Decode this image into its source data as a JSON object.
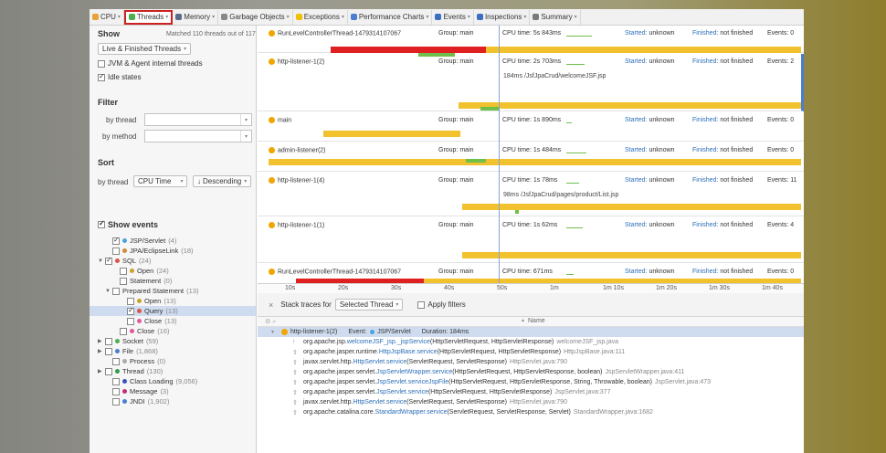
{
  "tabs": [
    {
      "label": "CPU",
      "icon": "cpu-icon",
      "color": "#e8a13b",
      "active": false
    },
    {
      "label": "Threads",
      "icon": "threads-icon",
      "color": "#4caf50",
      "active": true
    },
    {
      "label": "Memory",
      "icon": "memory-icon",
      "color": "#5a6b8a",
      "active": false
    },
    {
      "label": "Garbage Objects",
      "icon": "garbage-icon",
      "color": "#888888",
      "active": false
    },
    {
      "label": "Exceptions",
      "icon": "lightning-icon",
      "color": "#f0c000",
      "active": false
    },
    {
      "label": "Performance Charts",
      "icon": "chart-icon",
      "color": "#4a7fd0",
      "active": false
    },
    {
      "label": "Events",
      "icon": "events-icon",
      "color": "#3a6fc0",
      "active": false
    },
    {
      "label": "Inspections",
      "icon": "inspections-icon",
      "color": "#3a6fc0",
      "active": false
    },
    {
      "label": "Summary",
      "icon": "summary-icon",
      "color": "#7a7a7a",
      "active": false
    }
  ],
  "left": {
    "show_title": "Show",
    "matched": "Matched 110 threads out of 117",
    "filter_mode": "Live & Finished Threads",
    "jvm_agent": "JVM & Agent internal threads",
    "idle_states": "Idle states",
    "filter_title": "Filter",
    "by_thread": "by thread",
    "by_method": "by method",
    "sort_title": "Sort",
    "sort_by": "by thread",
    "sort_field": "CPU Time",
    "sort_order": "Descending",
    "show_events": "Show events",
    "tree": [
      {
        "label": "JSP/Servlet",
        "count": "(4)",
        "color": "#4aa3e0",
        "checked": true,
        "indent": 1,
        "expander": "",
        "sel": false
      },
      {
        "label": "JPA/EclipseLink",
        "count": "(18)",
        "color": "#d08a3a",
        "checked": false,
        "indent": 1,
        "expander": "",
        "sel": false
      },
      {
        "label": "SQL",
        "count": "(24)",
        "color": "#e0534a",
        "checked": true,
        "indent": 0,
        "expander": "▼",
        "sel": false
      },
      {
        "label": "Open",
        "count": "(24)",
        "color": "#c9a227",
        "checked": false,
        "indent": 2,
        "expander": "",
        "sel": false
      },
      {
        "label": "Statement",
        "count": "(0)",
        "color": "",
        "checked": false,
        "indent": 2,
        "expander": "",
        "sel": false
      },
      {
        "label": "Prepared Statement",
        "count": "(13)",
        "color": "",
        "checked": false,
        "indent": 1,
        "expander": "▼",
        "sel": false
      },
      {
        "label": "Open",
        "count": "(13)",
        "color": "#c9a227",
        "checked": false,
        "indent": 3,
        "expander": "",
        "sel": false
      },
      {
        "label": "Query",
        "count": "(13)",
        "color": "#e0534a",
        "checked": true,
        "indent": 3,
        "expander": "",
        "sel": true
      },
      {
        "label": "Close",
        "count": "(13)",
        "color": "#e05aa0",
        "checked": false,
        "indent": 3,
        "expander": "",
        "sel": false
      },
      {
        "label": "Close",
        "count": "(16)",
        "color": "#e05aa0",
        "checked": false,
        "indent": 2,
        "expander": "",
        "sel": false
      },
      {
        "label": "Socket",
        "count": "(59)",
        "color": "#4caf50",
        "checked": false,
        "indent": 0,
        "expander": "▶",
        "sel": false
      },
      {
        "label": "File",
        "count": "(1,868)",
        "color": "#4a7fd0",
        "checked": false,
        "indent": 0,
        "expander": "▶",
        "sel": false
      },
      {
        "label": "Process",
        "count": "(0)",
        "color": "#aaaaaa",
        "checked": false,
        "indent": 1,
        "expander": "",
        "sel": false
      },
      {
        "label": "Thread",
        "count": "(130)",
        "color": "#2e9c4a",
        "checked": false,
        "indent": 0,
        "expander": "▶",
        "sel": false
      },
      {
        "label": "Class Loading",
        "count": "(9,056)",
        "color": "#3355bb",
        "checked": false,
        "indent": 1,
        "expander": "",
        "sel": false
      },
      {
        "label": "Message",
        "count": "(3)",
        "color": "#c0307a",
        "checked": false,
        "indent": 1,
        "expander": "",
        "sel": false
      },
      {
        "label": "JNDI",
        "count": "(1,902)",
        "color": "#4a7fd0",
        "checked": false,
        "indent": 1,
        "expander": "",
        "sel": false
      }
    ]
  },
  "threads": [
    {
      "name": "RunLevelControllerThread-1479314107067",
      "group": "Group: main",
      "cpu": "CPU time: 5s 843ms",
      "started": "unknown",
      "finished": "not finished",
      "events": "Events: 0",
      "sub": ""
    },
    {
      "name": "http-listener-1(2)",
      "group": "Group: main",
      "cpu": "CPU time: 2s 703ms",
      "started": "unknown",
      "finished": "not finished",
      "events": "Events: 2",
      "sub": "184ms /JsfJpaCrud/welcomeJSF.jsp"
    },
    {
      "name": "main",
      "group": "Group: main",
      "cpu": "CPU time: 1s 890ms",
      "started": "unknown",
      "finished": "not finished",
      "events": "Events: 0",
      "sub": ""
    },
    {
      "name": "admin-listener(2)",
      "group": "Group: main",
      "cpu": "CPU time: 1s 484ms",
      "started": "unknown",
      "finished": "not finished",
      "events": "Events: 0",
      "sub": ""
    },
    {
      "name": "http-listener-1(4)",
      "group": "Group: main",
      "cpu": "CPU time: 1s 78ms",
      "started": "unknown",
      "finished": "not finished",
      "events": "Events: 11",
      "sub": "98ms /JsfJpaCrud/pages/product/List.jsp"
    },
    {
      "name": "http-listener-1(1)",
      "group": "Group: main",
      "cpu": "CPU time: 1s 62ms",
      "started": "unknown",
      "finished": "not finished",
      "events": "Events: 4",
      "sub": ""
    },
    {
      "name": "RunLevelControllerThread-1479314107067",
      "group": "Group: main",
      "cpu": "CPU time: 671ms",
      "started": "unknown",
      "finished": "not finished",
      "events": "Events: 0",
      "sub": ""
    }
  ],
  "labels": {
    "started": "Started:",
    "finished": "Finished:"
  },
  "timescale": [
    "10s",
    "20s",
    "30s",
    "40s",
    "50s",
    "1m",
    "1m 10s",
    "1m 20s",
    "1m 30s",
    "1m 40s"
  ],
  "stack": {
    "close": "×",
    "label": "Stack traces for",
    "mode": "Selected Thread",
    "apply": "Apply filters",
    "name_header": "Name",
    "sort_arrow": "▲",
    "header_icons": "⚙ ⌕",
    "root": {
      "thread": "http-listener-1(2)",
      "event_label": "Event:",
      "event": "JSP/Servlet",
      "duration": "Duration: 184ms"
    },
    "frames": [
      {
        "pkg": "org.apache.jsp.",
        "method": "welcomeJSF_jsp._jspService",
        "args": "(HttpServletRequest, HttpServletResponse)",
        "file": "welcomeJSF_jsp.java",
        "icon": "↑"
      },
      {
        "pkg": "org.apache.jasper.runtime.",
        "method": "HttpJspBase.service",
        "args": "(HttpServletRequest, HttpServletResponse)",
        "file": "HttpJspBase.java:111",
        "icon": "⇧"
      },
      {
        "pkg": "javax.servlet.http.",
        "method": "HttpServlet.service",
        "args": "(ServletRequest, ServletResponse)",
        "file": "HttpServlet.java:790",
        "icon": "⇧"
      },
      {
        "pkg": "org.apache.jasper.servlet.",
        "method": "JspServletWrapper.service",
        "args": "(HttpServletRequest, HttpServletResponse, boolean)",
        "file": "JspServletWrapper.java:411",
        "icon": "⇧"
      },
      {
        "pkg": "org.apache.jasper.servlet.",
        "method": "JspServlet.serviceJspFile",
        "args": "(HttpServletRequest, HttpServletResponse, String, Throwable, boolean)",
        "file": "JspServlet.java:473",
        "icon": "⇧"
      },
      {
        "pkg": "org.apache.jasper.servlet.",
        "method": "JspServlet.service",
        "args": "(HttpServletRequest, HttpServletResponse)",
        "file": "JspServlet.java:377",
        "icon": "⇧"
      },
      {
        "pkg": "javax.servlet.http.",
        "method": "HttpServlet.service",
        "args": "(ServletRequest, ServletResponse)",
        "file": "HttpServlet.java:790",
        "icon": "⇧"
      },
      {
        "pkg": "org.apache.catalina.core.",
        "method": "StandardWrapper.service",
        "args": "(ServletRequest, ServletResponse, Servlet)",
        "file": "StandardWrapper.java:1682",
        "icon": "⇧"
      }
    ]
  },
  "colors": {
    "running": "#f2c12e",
    "blocked": "#e02020",
    "waiting": "#6fbf4a",
    "accent": "#2c6fb8",
    "selection": "#cfdcef"
  }
}
